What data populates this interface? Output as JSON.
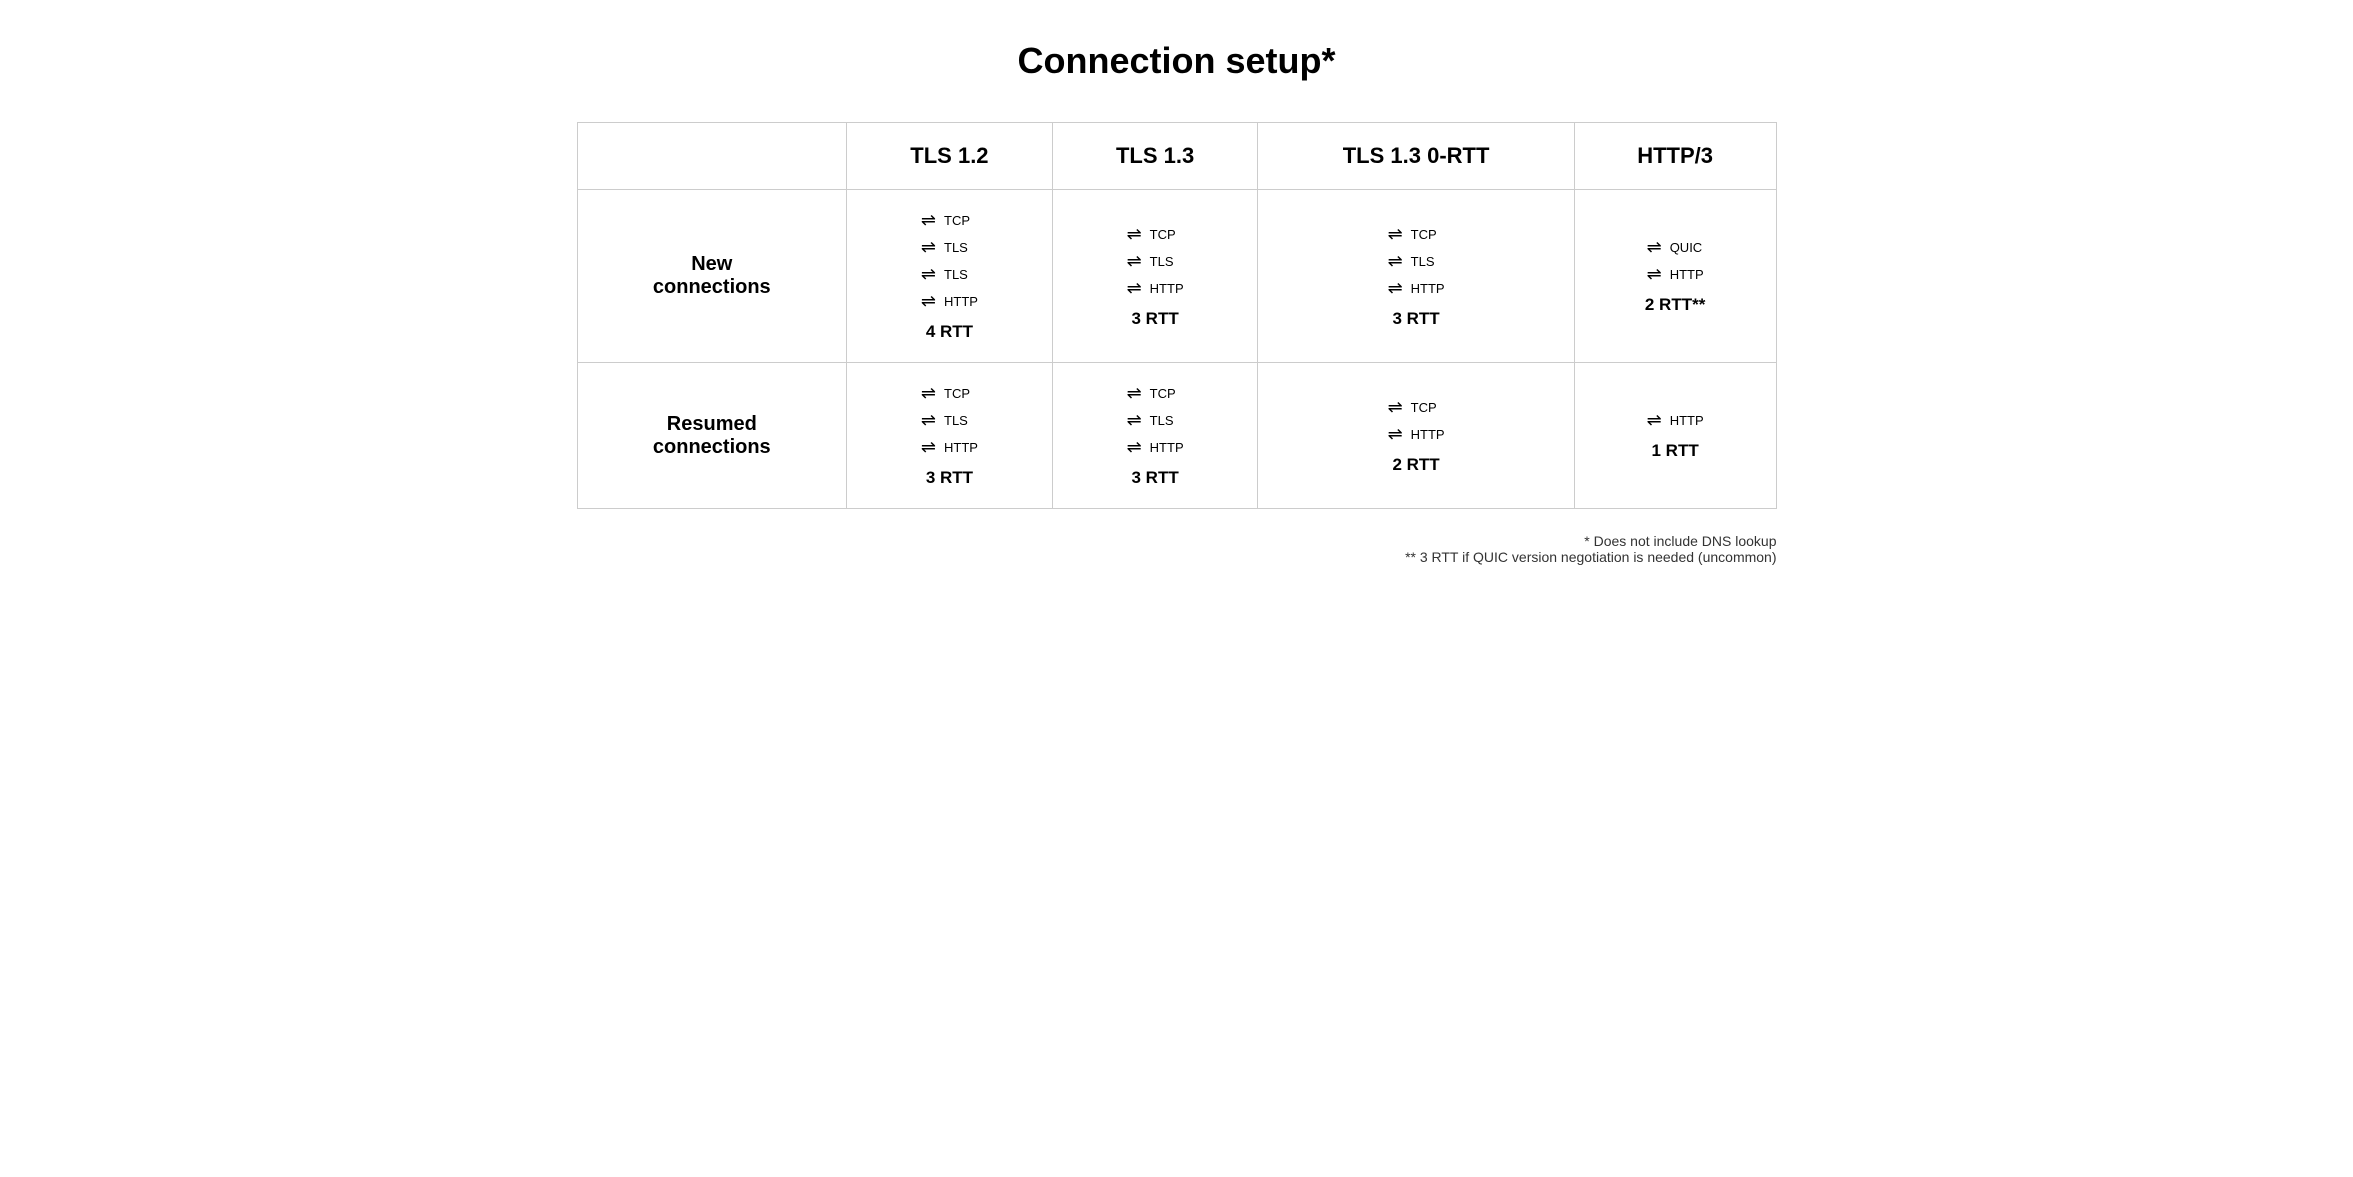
{
  "title": "Connection setup*",
  "columns": [
    "",
    "TLS 1.2",
    "TLS 1.3",
    "TLS 1.3 0-RTT",
    "HTTP/3"
  ],
  "rows": [
    {
      "label": "New\nconnections",
      "cells": [
        {
          "arrows": [
            {
              "label": "TCP"
            },
            {
              "label": "TLS"
            },
            {
              "label": "TLS"
            },
            {
              "label": "HTTP"
            }
          ],
          "rtt": "4 RTT"
        },
        {
          "arrows": [
            {
              "label": "TCP"
            },
            {
              "label": "TLS"
            },
            {
              "label": "HTTP"
            }
          ],
          "rtt": "3 RTT"
        },
        {
          "arrows": [
            {
              "label": "TCP"
            },
            {
              "label": "TLS"
            },
            {
              "label": "HTTP"
            }
          ],
          "rtt": "3 RTT"
        },
        {
          "arrows": [
            {
              "label": "QUIC"
            },
            {
              "label": "HTTP"
            }
          ],
          "rtt": "2 RTT**"
        }
      ]
    },
    {
      "label": "Resumed\nconnections",
      "cells": [
        {
          "arrows": [
            {
              "label": "TCP"
            },
            {
              "label": "TLS"
            },
            {
              "label": "HTTP"
            }
          ],
          "rtt": "3 RTT"
        },
        {
          "arrows": [
            {
              "label": "TCP"
            },
            {
              "label": "TLS"
            },
            {
              "label": "HTTP"
            }
          ],
          "rtt": "3 RTT"
        },
        {
          "arrows": [
            {
              "label": "TCP"
            },
            {
              "label": "HTTP"
            }
          ],
          "rtt": "2 RTT"
        },
        {
          "arrows": [
            {
              "label": "HTTP"
            }
          ],
          "rtt": "1 RTT"
        }
      ]
    }
  ],
  "footnotes": [
    "* Does not include DNS lookup",
    "** 3 RTT if QUIC version negotiation is needed (uncommon)"
  ]
}
